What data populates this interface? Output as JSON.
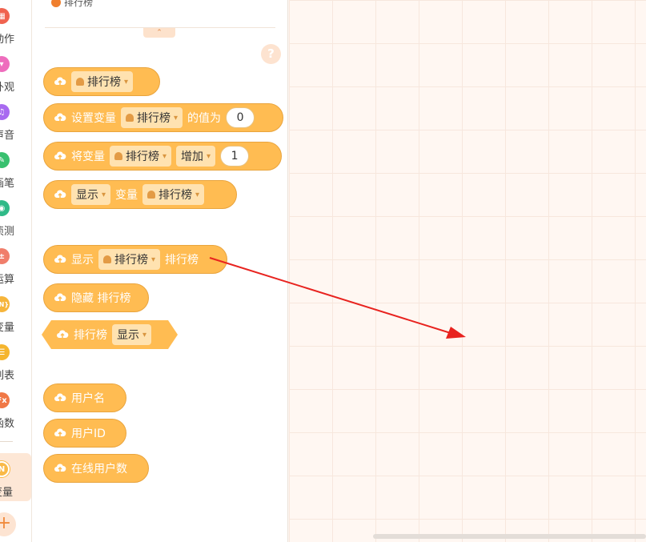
{
  "colors": {
    "accent": "#ffbc52",
    "arrow": "#e8231f"
  },
  "categories": [
    {
      "label": "动作",
      "color": "#f0634f",
      "icon": "film-icon",
      "glyph": "▦"
    },
    {
      "label": "外观",
      "color": "#ee6dbd",
      "icon": "shirt-icon",
      "glyph": "▾"
    },
    {
      "label": "声音",
      "color": "#a86af0",
      "icon": "music-icon",
      "glyph": "♫"
    },
    {
      "label": "画笔",
      "color": "#38c06f",
      "icon": "pen-icon",
      "glyph": "✎"
    },
    {
      "label": "侦测",
      "color": "#2fba88",
      "icon": "sensor-icon",
      "glyph": "◉"
    },
    {
      "label": "运算",
      "color": "#f07e6b",
      "icon": "math-icon",
      "glyph": "±"
    },
    {
      "label": "变量",
      "color": "#f6b53b",
      "icon": "variable-icon",
      "glyph": "{N}"
    },
    {
      "label": "列表",
      "color": "#f5b52e",
      "icon": "list-icon",
      "glyph": "☰"
    },
    {
      "label": "函数",
      "color": "#f07846",
      "icon": "function-icon",
      "glyph": "Fx"
    },
    {
      "label": "变量",
      "color": "#f9b947",
      "icon": "cloud-variable-icon",
      "glyph": "N"
    }
  ],
  "palette": {
    "header": "排行榜",
    "collapse_glyph": "⌃",
    "help_glyph": "?",
    "blocks": {
      "b1": {
        "var": "排行榜"
      },
      "b2": {
        "set": "设置变量",
        "var": "排行榜",
        "value_of": "的值为",
        "num": "0"
      },
      "b3": {
        "change": "将变量",
        "var": "排行榜",
        "op": "增加",
        "num": "1"
      },
      "b4": {
        "mode": "显示",
        "var_label": "变量",
        "var": "排行榜"
      },
      "b5": {
        "show": "显示",
        "var": "排行榜",
        "tail": "排行榜"
      },
      "b6": {
        "hide": "隐藏 排行榜"
      },
      "b7": {
        "name": "排行榜",
        "mode": "显示"
      },
      "b8": {
        "label": "用户名"
      },
      "b9": {
        "label": "用户ID"
      },
      "b10": {
        "label": "在线用户数"
      }
    }
  },
  "add_glyph": "+"
}
